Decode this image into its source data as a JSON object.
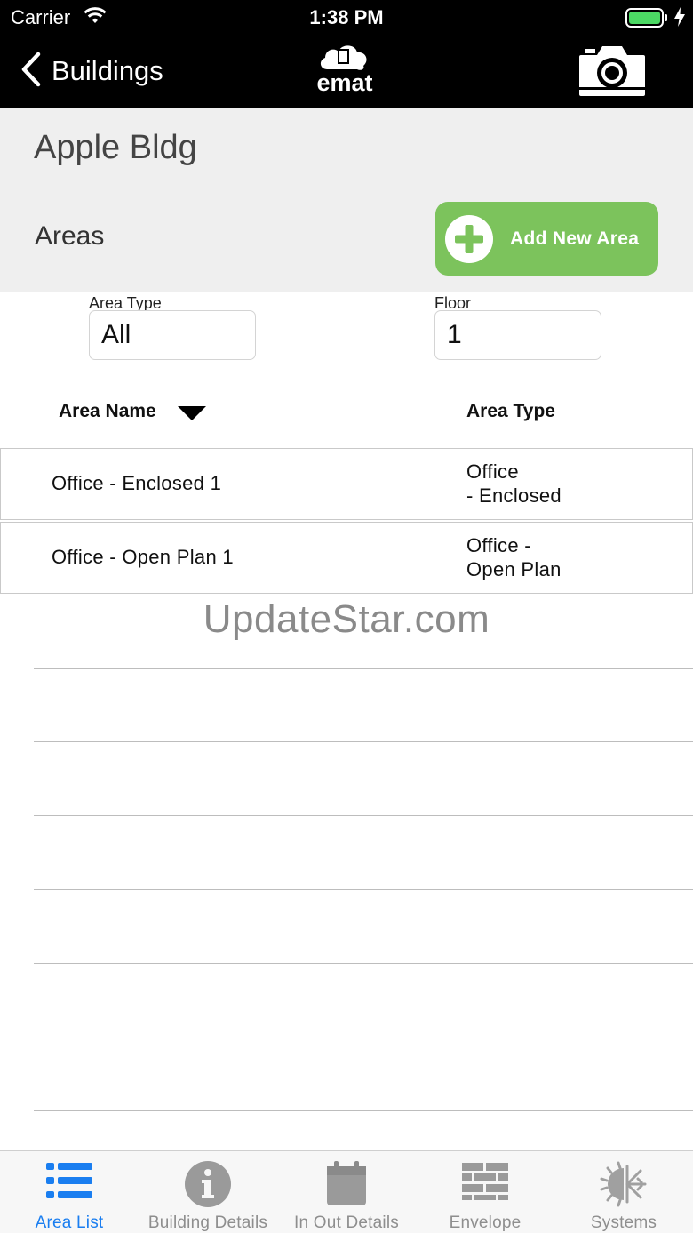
{
  "status_bar": {
    "carrier": "Carrier",
    "time": "1:38 PM"
  },
  "nav": {
    "back_label": "Buildings",
    "logo_text": "emat",
    "camera_icon": "camera-icon"
  },
  "header": {
    "building_name": "Apple Bldg",
    "section_label": "Areas",
    "add_button_label": "Add New Area"
  },
  "filters": {
    "area_type_label": "Area Type",
    "area_type_value": "All",
    "floor_label": "Floor",
    "floor_value": "1"
  },
  "table": {
    "columns": [
      "Area Name",
      "Area Type"
    ],
    "rows": [
      {
        "name": "Office - Enclosed 1",
        "type_line1": "Office",
        "type_line2": "- Enclosed"
      },
      {
        "name": "Office - Open Plan 1",
        "type_line1": "Office -",
        "type_line2": "Open Plan"
      }
    ]
  },
  "watermark": "UpdateStar.com",
  "tabs": [
    {
      "label": "Area List",
      "icon": "list-icon",
      "active": true
    },
    {
      "label": "Building Details",
      "icon": "info-icon",
      "active": false
    },
    {
      "label": "In Out Details",
      "icon": "calendar-icon",
      "active": false
    },
    {
      "label": "Envelope",
      "icon": "brick-wall-icon",
      "active": false
    },
    {
      "label": "Systems",
      "icon": "sun-snowflake-icon",
      "active": false
    }
  ],
  "colors": {
    "accent_green": "#7cc35c",
    "active_tab_blue": "#1a7ef0",
    "inactive_tab_gray": "#8e8e8e"
  }
}
